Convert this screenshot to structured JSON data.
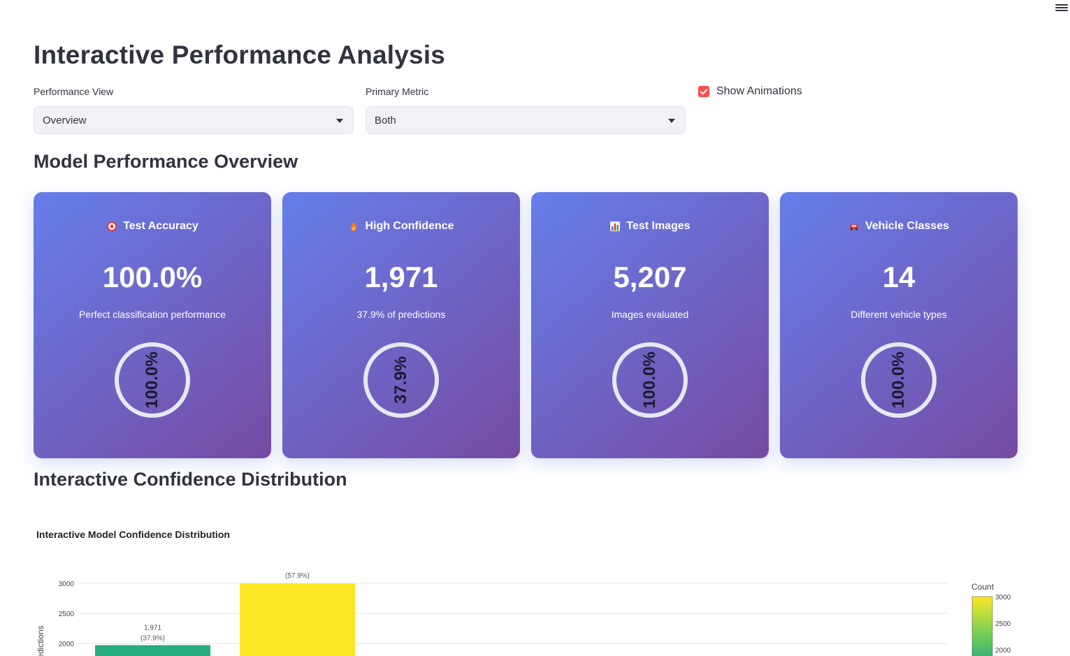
{
  "header": {
    "menu_icon": "hamburger-menu-icon"
  },
  "title": "Interactive Performance Analysis",
  "controls": {
    "performance_view": {
      "label": "Performance View",
      "value": "Overview"
    },
    "primary_metric": {
      "label": "Primary Metric",
      "value": "Both"
    },
    "show_animations": {
      "label": "Show Animations",
      "checked": true
    }
  },
  "sections": {
    "overview": "Model Performance Overview",
    "confidence": "Interactive Confidence Distribution"
  },
  "cards": [
    {
      "icon": "target-icon",
      "title": "Test Accuracy",
      "value": "100.0%",
      "subtitle": "Perfect classification performance",
      "ring": "100.0%"
    },
    {
      "icon": "fire-icon",
      "title": "High Confidence",
      "value": "1,971",
      "subtitle": "37.9% of predictions",
      "ring": "37.9%"
    },
    {
      "icon": "chart-icon",
      "title": "Test Images",
      "value": "5,207",
      "subtitle": "Images evaluated",
      "ring": "100.0%"
    },
    {
      "icon": "car-icon",
      "title": "Vehicle Classes",
      "value": "14",
      "subtitle": "Different vehicle types",
      "ring": "100.0%"
    }
  ],
  "colors": {
    "card_gradient_start": "#667eea",
    "card_gradient_end": "#764ba2",
    "checkbox": "#ff4b4b"
  },
  "chart_data": {
    "type": "bar",
    "title": "Interactive Model Confidence Distribution",
    "ylabel": "Predictions",
    "yticks": [
      2000,
      2500,
      3000
    ],
    "bars": [
      {
        "value": 1971,
        "label": "1,971",
        "pct": "(37.9%)",
        "color": "#27ad81"
      },
      {
        "value": 3015,
        "label": "",
        "pct": "(57.9%)",
        "color": "#fde725"
      }
    ],
    "colorbar": {
      "title": "Count",
      "ticks": [
        3000,
        2500,
        2000
      ]
    }
  }
}
